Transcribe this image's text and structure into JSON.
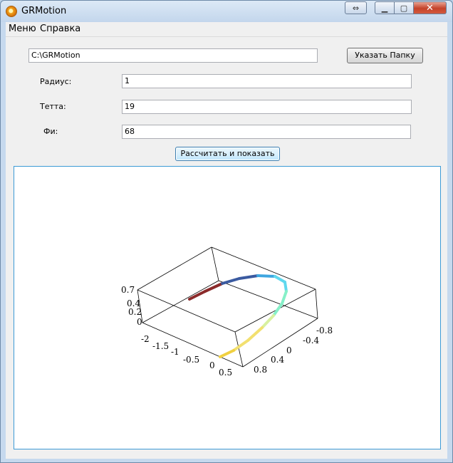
{
  "window": {
    "title": "GRMotion"
  },
  "menu": {
    "items": [
      "Меню",
      "Справка"
    ]
  },
  "path": {
    "value": "C:\\GRMotion",
    "button_label": "Указать Папку"
  },
  "params": [
    {
      "label": "Радиус:",
      "value": "1"
    },
    {
      "label": "Тетта:",
      "value": "19"
    },
    {
      "label": "Фи:",
      "value": "68"
    }
  ],
  "compute": {
    "label": "Рассчитать и показать"
  },
  "plot": {
    "z_ticks": [
      "0.7",
      "0.4",
      "0.2",
      "0"
    ],
    "x_ticks": [
      "-2",
      "-1.5",
      "-1",
      "-0.5",
      "0",
      "0.5"
    ],
    "y_ticks": [
      "-0.8",
      "-0.4",
      "0",
      "0.4",
      "0.8"
    ],
    "curve_colors": [
      "#8b2a2a",
      "#3a5aa0",
      "#3ea6e0",
      "#5fd8ee",
      "#86f0c8",
      "#d8f0a0",
      "#f2e070",
      "#f0d040"
    ]
  }
}
